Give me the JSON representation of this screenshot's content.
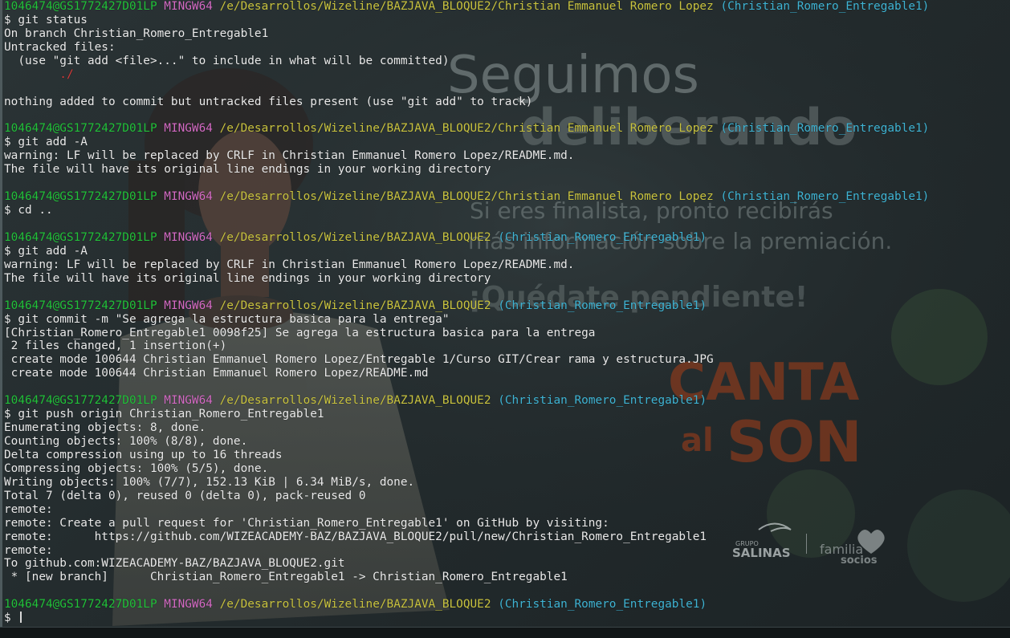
{
  "terminal": {
    "colors": {
      "user_host": "#22c13a",
      "shell": "#d36ac3",
      "path": "#c9c33f",
      "branch": "#3fb4d4",
      "text": "#eaeaea",
      "untracked": "#d23b3b"
    },
    "lines": [
      [
        {
          "t": "1046474@GS1772427D01LP",
          "c": "user_host"
        },
        {
          "t": " "
        },
        {
          "t": "MINGW64",
          "c": "shell"
        },
        {
          "t": " "
        },
        {
          "t": "/e/Desarrollos/Wizeline/BAZJAVA_BLOQUE2/Christian Emmanuel Romero Lopez",
          "c": "path"
        },
        {
          "t": " "
        },
        {
          "t": "(Christian_Romero_Entregable1)",
          "c": "branch"
        }
      ],
      [
        {
          "t": "$ git status"
        }
      ],
      [
        {
          "t": "On branch Christian_Romero_Entregable1"
        }
      ],
      [
        {
          "t": "Untracked files:"
        }
      ],
      [
        {
          "t": "  (use \"git add <file>...\" to include in what will be committed)"
        }
      ],
      [
        {
          "t": "        ./",
          "c": "untracked"
        }
      ],
      [],
      [
        {
          "t": "nothing added to commit but untracked files present (use \"git add\" to track)"
        }
      ],
      [],
      [
        {
          "t": "1046474@GS1772427D01LP",
          "c": "user_host"
        },
        {
          "t": " "
        },
        {
          "t": "MINGW64",
          "c": "shell"
        },
        {
          "t": " "
        },
        {
          "t": "/e/Desarrollos/Wizeline/BAZJAVA_BLOQUE2/Christian Emmanuel Romero Lopez",
          "c": "path"
        },
        {
          "t": " "
        },
        {
          "t": "(Christian_Romero_Entregable1)",
          "c": "branch"
        }
      ],
      [
        {
          "t": "$ git add -A"
        }
      ],
      [
        {
          "t": "warning: LF will be replaced by CRLF in Christian Emmanuel Romero Lopez/README.md."
        }
      ],
      [
        {
          "t": "The file will have its original line endings in your working directory"
        }
      ],
      [],
      [
        {
          "t": "1046474@GS1772427D01LP",
          "c": "user_host"
        },
        {
          "t": " "
        },
        {
          "t": "MINGW64",
          "c": "shell"
        },
        {
          "t": " "
        },
        {
          "t": "/e/Desarrollos/Wizeline/BAZJAVA_BLOQUE2/Christian Emmanuel Romero Lopez",
          "c": "path"
        },
        {
          "t": " "
        },
        {
          "t": "(Christian_Romero_Entregable1)",
          "c": "branch"
        }
      ],
      [
        {
          "t": "$ cd .."
        }
      ],
      [],
      [
        {
          "t": "1046474@GS1772427D01LP",
          "c": "user_host"
        },
        {
          "t": " "
        },
        {
          "t": "MINGW64",
          "c": "shell"
        },
        {
          "t": " "
        },
        {
          "t": "/e/Desarrollos/Wizeline/BAZJAVA_BLOQUE2",
          "c": "path"
        },
        {
          "t": " "
        },
        {
          "t": "(Christian_Romero_Entregable1)",
          "c": "branch"
        }
      ],
      [
        {
          "t": "$ git add -A"
        }
      ],
      [
        {
          "t": "warning: LF will be replaced by CRLF in Christian Emmanuel Romero Lopez/README.md."
        }
      ],
      [
        {
          "t": "The file will have its original line endings in your working directory"
        }
      ],
      [],
      [
        {
          "t": "1046474@GS1772427D01LP",
          "c": "user_host"
        },
        {
          "t": " "
        },
        {
          "t": "MINGW64",
          "c": "shell"
        },
        {
          "t": " "
        },
        {
          "t": "/e/Desarrollos/Wizeline/BAZJAVA_BLOQUE2",
          "c": "path"
        },
        {
          "t": " "
        },
        {
          "t": "(Christian_Romero_Entregable1)",
          "c": "branch"
        }
      ],
      [
        {
          "t": "$ git commit -m \"Se agrega la estructura basica para la entrega\""
        }
      ],
      [
        {
          "t": "[Christian_Romero_Entregable1 0098f25] Se agrega la estructura basica para la entrega"
        }
      ],
      [
        {
          "t": " 2 files changed, 1 insertion(+)"
        }
      ],
      [
        {
          "t": " create mode 100644 Christian Emmanuel Romero Lopez/Entregable 1/Curso GIT/Crear rama y estructura.JPG"
        }
      ],
      [
        {
          "t": " create mode 100644 Christian Emmanuel Romero Lopez/README.md"
        }
      ],
      [],
      [
        {
          "t": "1046474@GS1772427D01LP",
          "c": "user_host"
        },
        {
          "t": " "
        },
        {
          "t": "MINGW64",
          "c": "shell"
        },
        {
          "t": " "
        },
        {
          "t": "/e/Desarrollos/Wizeline/BAZJAVA_BLOQUE2",
          "c": "path"
        },
        {
          "t": " "
        },
        {
          "t": "(Christian_Romero_Entregable1)",
          "c": "branch"
        }
      ],
      [
        {
          "t": "$ git push origin Christian_Romero_Entregable1"
        }
      ],
      [
        {
          "t": "Enumerating objects: 8, done."
        }
      ],
      [
        {
          "t": "Counting objects: 100% (8/8), done."
        }
      ],
      [
        {
          "t": "Delta compression using up to 16 threads"
        }
      ],
      [
        {
          "t": "Compressing objects: 100% (5/5), done."
        }
      ],
      [
        {
          "t": "Writing objects: 100% (7/7), 152.13 KiB | 6.34 MiB/s, done."
        }
      ],
      [
        {
          "t": "Total 7 (delta 0), reused 0 (delta 0), pack-reused 0"
        }
      ],
      [
        {
          "t": "remote:"
        }
      ],
      [
        {
          "t": "remote: Create a pull request for 'Christian_Romero_Entregable1' on GitHub by visiting:"
        }
      ],
      [
        {
          "t": "remote:      https://github.com/WIZEACADEMY-BAZ/BAZJAVA_BLOQUE2/pull/new/Christian_Romero_Entregable1"
        }
      ],
      [
        {
          "t": "remote:"
        }
      ],
      [
        {
          "t": "To github.com:WIZEACADEMY-BAZ/BAZJAVA_BLOQUE2.git"
        }
      ],
      [
        {
          "t": " * [new branch]      Christian_Romero_Entregable1 -> Christian_Romero_Entregable1"
        }
      ],
      [],
      [
        {
          "t": "1046474@GS1772427D01LP",
          "c": "user_host"
        },
        {
          "t": " "
        },
        {
          "t": "MINGW64",
          "c": "shell"
        },
        {
          "t": " "
        },
        {
          "t": "/e/Desarrollos/Wizeline/BAZJAVA_BLOQUE2",
          "c": "path"
        },
        {
          "t": " "
        },
        {
          "t": "(Christian_Romero_Entregable1)",
          "c": "branch"
        }
      ],
      [
        {
          "t": "$ "
        }
      ]
    ]
  },
  "background": {
    "headline_1": "Seguimos",
    "headline_2": "deliberando",
    "body_1": "Si eres finalista, pronto recibirás",
    "body_2": "más información sobre la premiación.",
    "callout": "¡Quédate pendiente!",
    "event_logo_1": "CANTA",
    "event_logo_2": "al",
    "event_logo_3": "SON",
    "sponsor_1_small": "GRUPO",
    "sponsor_1": "SALINAS",
    "sponsor_2_a": "familia",
    "sponsor_2_b": "socios",
    "colors": {
      "headline_text": "#8f9a9a",
      "event_logo": "#8a3a1c"
    }
  }
}
